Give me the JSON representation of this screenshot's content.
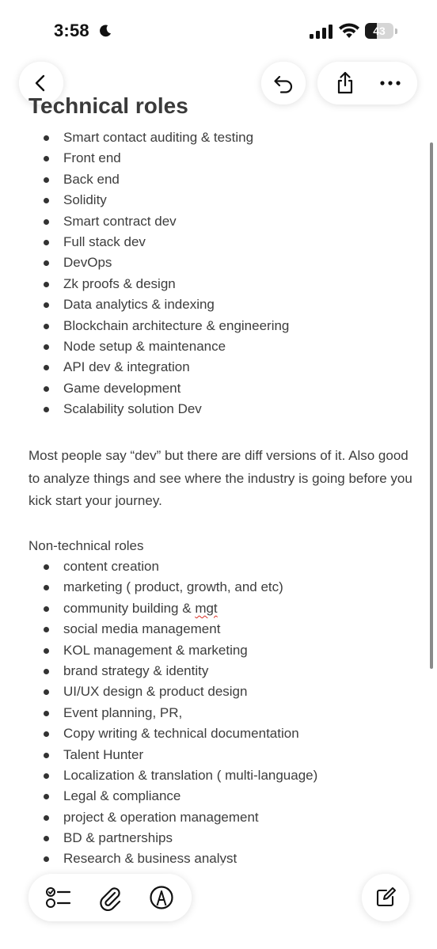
{
  "status_bar": {
    "time": "3:58",
    "battery_level": "43",
    "battery_fraction": 0.43,
    "icons": [
      "moon-icon",
      "signal-icon",
      "wifi-icon",
      "battery-icon"
    ]
  },
  "nav": {
    "icons": [
      "chevron-left-icon",
      "undo-icon",
      "share-icon",
      "more-icon"
    ]
  },
  "note": {
    "title": "Technical roles",
    "technical_roles": [
      "Smart contact auditing & testing",
      "Front end",
      "Back end",
      "Solidity",
      "Smart contract dev",
      "Full stack dev",
      "DevOps",
      "Zk proofs & design",
      "Data analytics & indexing",
      "Blockchain architecture & engineering",
      "Node setup & maintenance",
      "API dev & integration",
      "Game development",
      "Scalability solution Dev"
    ],
    "paragraph": "Most people say “dev” but there are diff versions of it. Also good to analyze things and see where the industry is going before you kick start your journey.",
    "nontech_heading": "Non-technical roles",
    "nontech_roles": [
      {
        "pre": "content creation",
        "err": "",
        "post": ""
      },
      {
        "pre": "marketing ( product, growth, and etc)",
        "err": "",
        "post": ""
      },
      {
        "pre": "community building & ",
        "err": "mgt",
        "post": ""
      },
      {
        "pre": "social media management",
        "err": "",
        "post": ""
      },
      {
        "pre": "KOL management & marketing",
        "err": "",
        "post": ""
      },
      {
        "pre": "brand strategy & identity",
        "err": "",
        "post": ""
      },
      {
        "pre": "UI/UX design & product design",
        "err": "",
        "post": ""
      },
      {
        "pre": "Event planning, PR,",
        "err": "",
        "post": ""
      },
      {
        "pre": "Copy writing & technical documentation",
        "err": "",
        "post": ""
      },
      {
        "pre": "Talent Hunter",
        "err": "",
        "post": ""
      },
      {
        "pre": "Localization & translation ( multi-language)",
        "err": "",
        "post": ""
      },
      {
        "pre": "Legal & compliance",
        "err": "",
        "post": ""
      },
      {
        "pre": "project & operation management",
        "err": "",
        "post": ""
      },
      {
        "pre": "BD & partnerships",
        "err": "",
        "post": ""
      },
      {
        "pre": "Research & business analyst",
        "err": "",
        "post": ""
      }
    ]
  },
  "toolbar": {
    "icons": [
      "checklist-icon",
      "paperclip-icon",
      "markup-pen-icon",
      "compose-icon"
    ]
  },
  "colors": {
    "text": "#3d3d3d",
    "spell_error": "#d93025",
    "background": "#ffffff"
  }
}
